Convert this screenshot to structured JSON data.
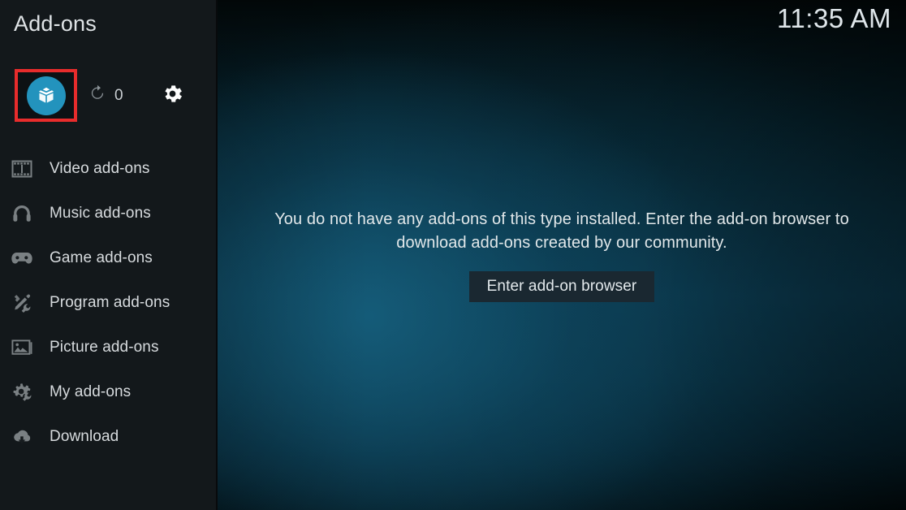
{
  "window": {
    "title": "Add-ons",
    "clock": "11:35 AM"
  },
  "colors": {
    "accent_circle": "#2393bd",
    "focus_highlight": "#e82c2c",
    "sidebar_bg": "#13181b",
    "background_teal": "#0d4057",
    "button_bg": "#1a2831",
    "text_primary": "#e2e8ea",
    "icon_muted": "#9aa3a8"
  },
  "controls": {
    "addon_browser": {
      "icon": "package-box-icon",
      "label": "Add-on browser",
      "focused": true
    },
    "updates": {
      "icon": "refresh-icon",
      "count": "0"
    },
    "settings": {
      "icon": "gear-icon",
      "label": "Settings"
    }
  },
  "sidebar": {
    "items": [
      {
        "label": "Video add-ons",
        "icon": "film-strip-icon"
      },
      {
        "label": "Music add-ons",
        "icon": "headphones-icon"
      },
      {
        "label": "Game add-ons",
        "icon": "gamepad-icon"
      },
      {
        "label": "Program add-ons",
        "icon": "pencil-wrench-icon"
      },
      {
        "label": "Picture add-ons",
        "icon": "picture-frame-icon"
      },
      {
        "label": "My add-ons",
        "icon": "gear-wrench-icon"
      },
      {
        "label": "Download",
        "icon": "cloud-download-icon"
      }
    ]
  },
  "main": {
    "empty_message": "You do not have any add-ons of this type installed. Enter the add-on browser to download add-ons created by our community.",
    "enter_browser_label": "Enter add-on browser"
  }
}
